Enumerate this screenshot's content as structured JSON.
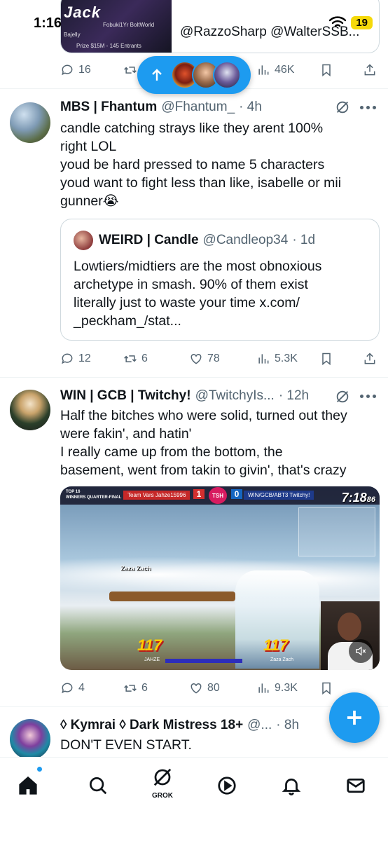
{
  "status_bar": {
    "time": "1:16",
    "battery": "19"
  },
  "top_card": {
    "thumb_title": "Jack",
    "thumb_sub": "Fobuki1Yr  BoltWorld",
    "thumb_sub2": "Bajelly",
    "thumb_sub3": "Prize $15M - 145 Entrants",
    "text": "@RazzoSharp @WalterSSB..."
  },
  "top_actions": {
    "replies": "16",
    "views": "46K"
  },
  "new_posts_pill": {
    "icon": "arrow-up-icon"
  },
  "tweets": [
    {
      "name": "MBS | Fhantum",
      "handle": "@Fhantum_",
      "time": "· 4h",
      "lines": [
        "candle catching strays like they arent 100%",
        "right LOL",
        "youd be hard pressed to name 5 characters",
        "youd want to fight less than like, isabelle or mii",
        "gunner😭"
      ],
      "quote": {
        "name": "WEIRD | Candle",
        "handle": "@Candleop34",
        "time": "· 1d",
        "lines": [
          "Lowtiers/midtiers are the most obnoxious",
          "archetype in smash. 90% of them exist",
          "literally just to waste your time x.com/",
          "_peckham_/stat..."
        ]
      },
      "actions": {
        "replies": "12",
        "reposts": "6",
        "likes": "78",
        "views": "5.3K"
      }
    },
    {
      "name": "WIN | GCB | Twitchy!",
      "handle": "@TwitchyIs...",
      "time": "· 12h",
      "lines": [
        "Half the bitches who were solid, turned out they",
        "were fakin', and hatin'",
        "I really came up from the bottom, the",
        "basement, went from takin to givin', that's crazy"
      ],
      "media": {
        "hud_round": "TOP 16",
        "hud_bracket": "WINNERS QUARTER-FINAL",
        "p1_tag": "Team Vars  Jahze15996",
        "p1_score": "1",
        "tsh": "TSH",
        "p2_score": "0",
        "p2_tag": "WIN/GCB/ABT3 Twitchy!",
        "timer": "7:18",
        "timer_ms": "86",
        "fighter_label": "Zaza Zach",
        "dmg1": "117",
        "dmg2": "117",
        "name1": "JAHZE",
        "name2": "Zaza Zach"
      },
      "actions": {
        "replies": "4",
        "reposts": "6",
        "likes": "80",
        "views": "9.3K"
      }
    },
    {
      "name": "◊ Kymrai ◊ Dark Mistress 18+",
      "handle": "@...",
      "time": "· 8h",
      "lines": [
        "DON'T EVEN START."
      ]
    }
  ],
  "tab_bar": {
    "grok_label": "GROK"
  }
}
